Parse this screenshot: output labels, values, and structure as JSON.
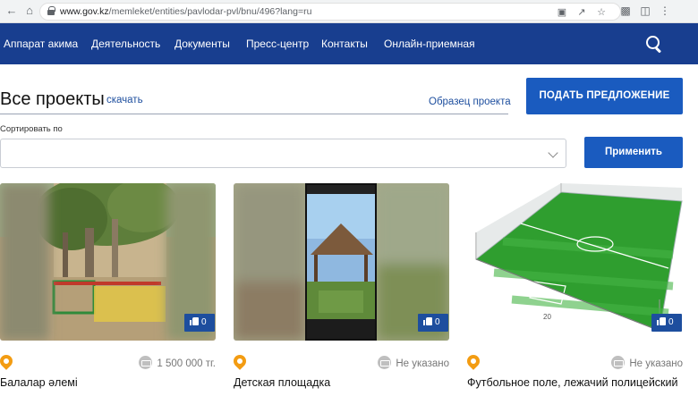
{
  "browser": {
    "url_host": "www.gov.kz",
    "url_path": "/memleket/entities/pavlodar-pvl/bnu/496?lang=ru"
  },
  "nav": {
    "items": [
      "Аппарат акима",
      "Деятельность",
      "Документы",
      "Пресс-центр",
      "Контакты",
      "Онлайн-приемная"
    ]
  },
  "header": {
    "title": "Все проекты",
    "download": "скачать",
    "sample": "Образец проекта",
    "propose_button": "ПОДАТЬ ПРЕДЛОЖЕНИЕ"
  },
  "sort": {
    "label": "Сортировать по",
    "value": "",
    "apply_button": "Применить"
  },
  "cards": [
    {
      "title": "Балалар әлемі",
      "budget": "1 500 000 тг.",
      "likes": "0"
    },
    {
      "title": "Детская площадка",
      "budget": "Не указано",
      "likes": "0"
    },
    {
      "title": "Футбольное поле, лежачий полицейский",
      "budget": "Не указано",
      "likes": "0"
    }
  ],
  "colors": {
    "nav_bg": "#183e8f",
    "button_bg": "#1a5bbf",
    "pin": "#f39c12",
    "link": "#1d4e9e"
  }
}
